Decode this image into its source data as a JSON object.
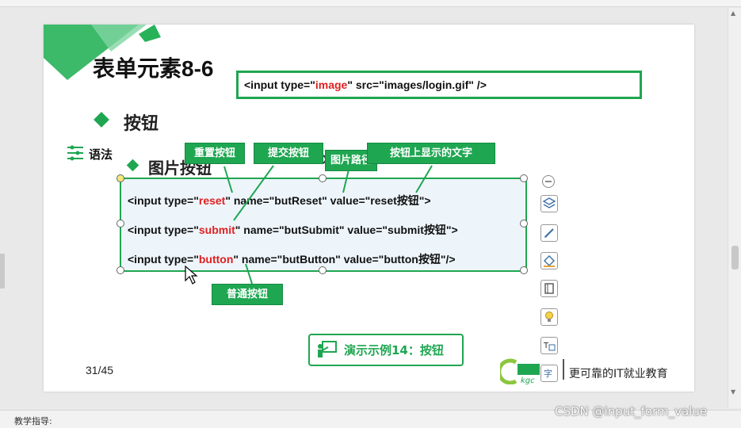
{
  "slide": {
    "title": "表单元素8-6",
    "bullet1": "按钮",
    "syntax_label": "语法",
    "bullet2": "图片按钮",
    "image_code": {
      "a": "<input  type=\"",
      "type": "image",
      "b": "\"  src=\"images/login.gif\" />"
    },
    "code_lines": [
      {
        "a": "<input  type=\"",
        "type": "reset",
        "b": "\" name=\"butReset\" value=\"reset按钮\">"
      },
      {
        "a": "<input  type=\"",
        "type": "submit",
        "b": "\" name=\"butSubmit\" value=\"submit按钮\">"
      },
      {
        "a": "<input  type=\"",
        "type": "button",
        "b": "\" name=\"butButton\" value=\"button按钮\"/>"
      }
    ],
    "callouts": {
      "reset": "重置按钮",
      "submit": "提交按钮",
      "img_path": "图片路径",
      "text": "按钮上显示的文字",
      "normal": "普通按钮"
    },
    "demo_button": "演示示例14：按钮",
    "page_number": "31/45",
    "logo_tagline": "更可靠的IT就业教育",
    "logo_text": "课工场",
    "logo_sub": "kgc"
  },
  "notes_label": "教学指导:",
  "watermark": "CSDN @input_form_value",
  "colors": {
    "accent": "#1fa651",
    "highlight": "#e02020",
    "box_fill": "#edf5fb"
  }
}
